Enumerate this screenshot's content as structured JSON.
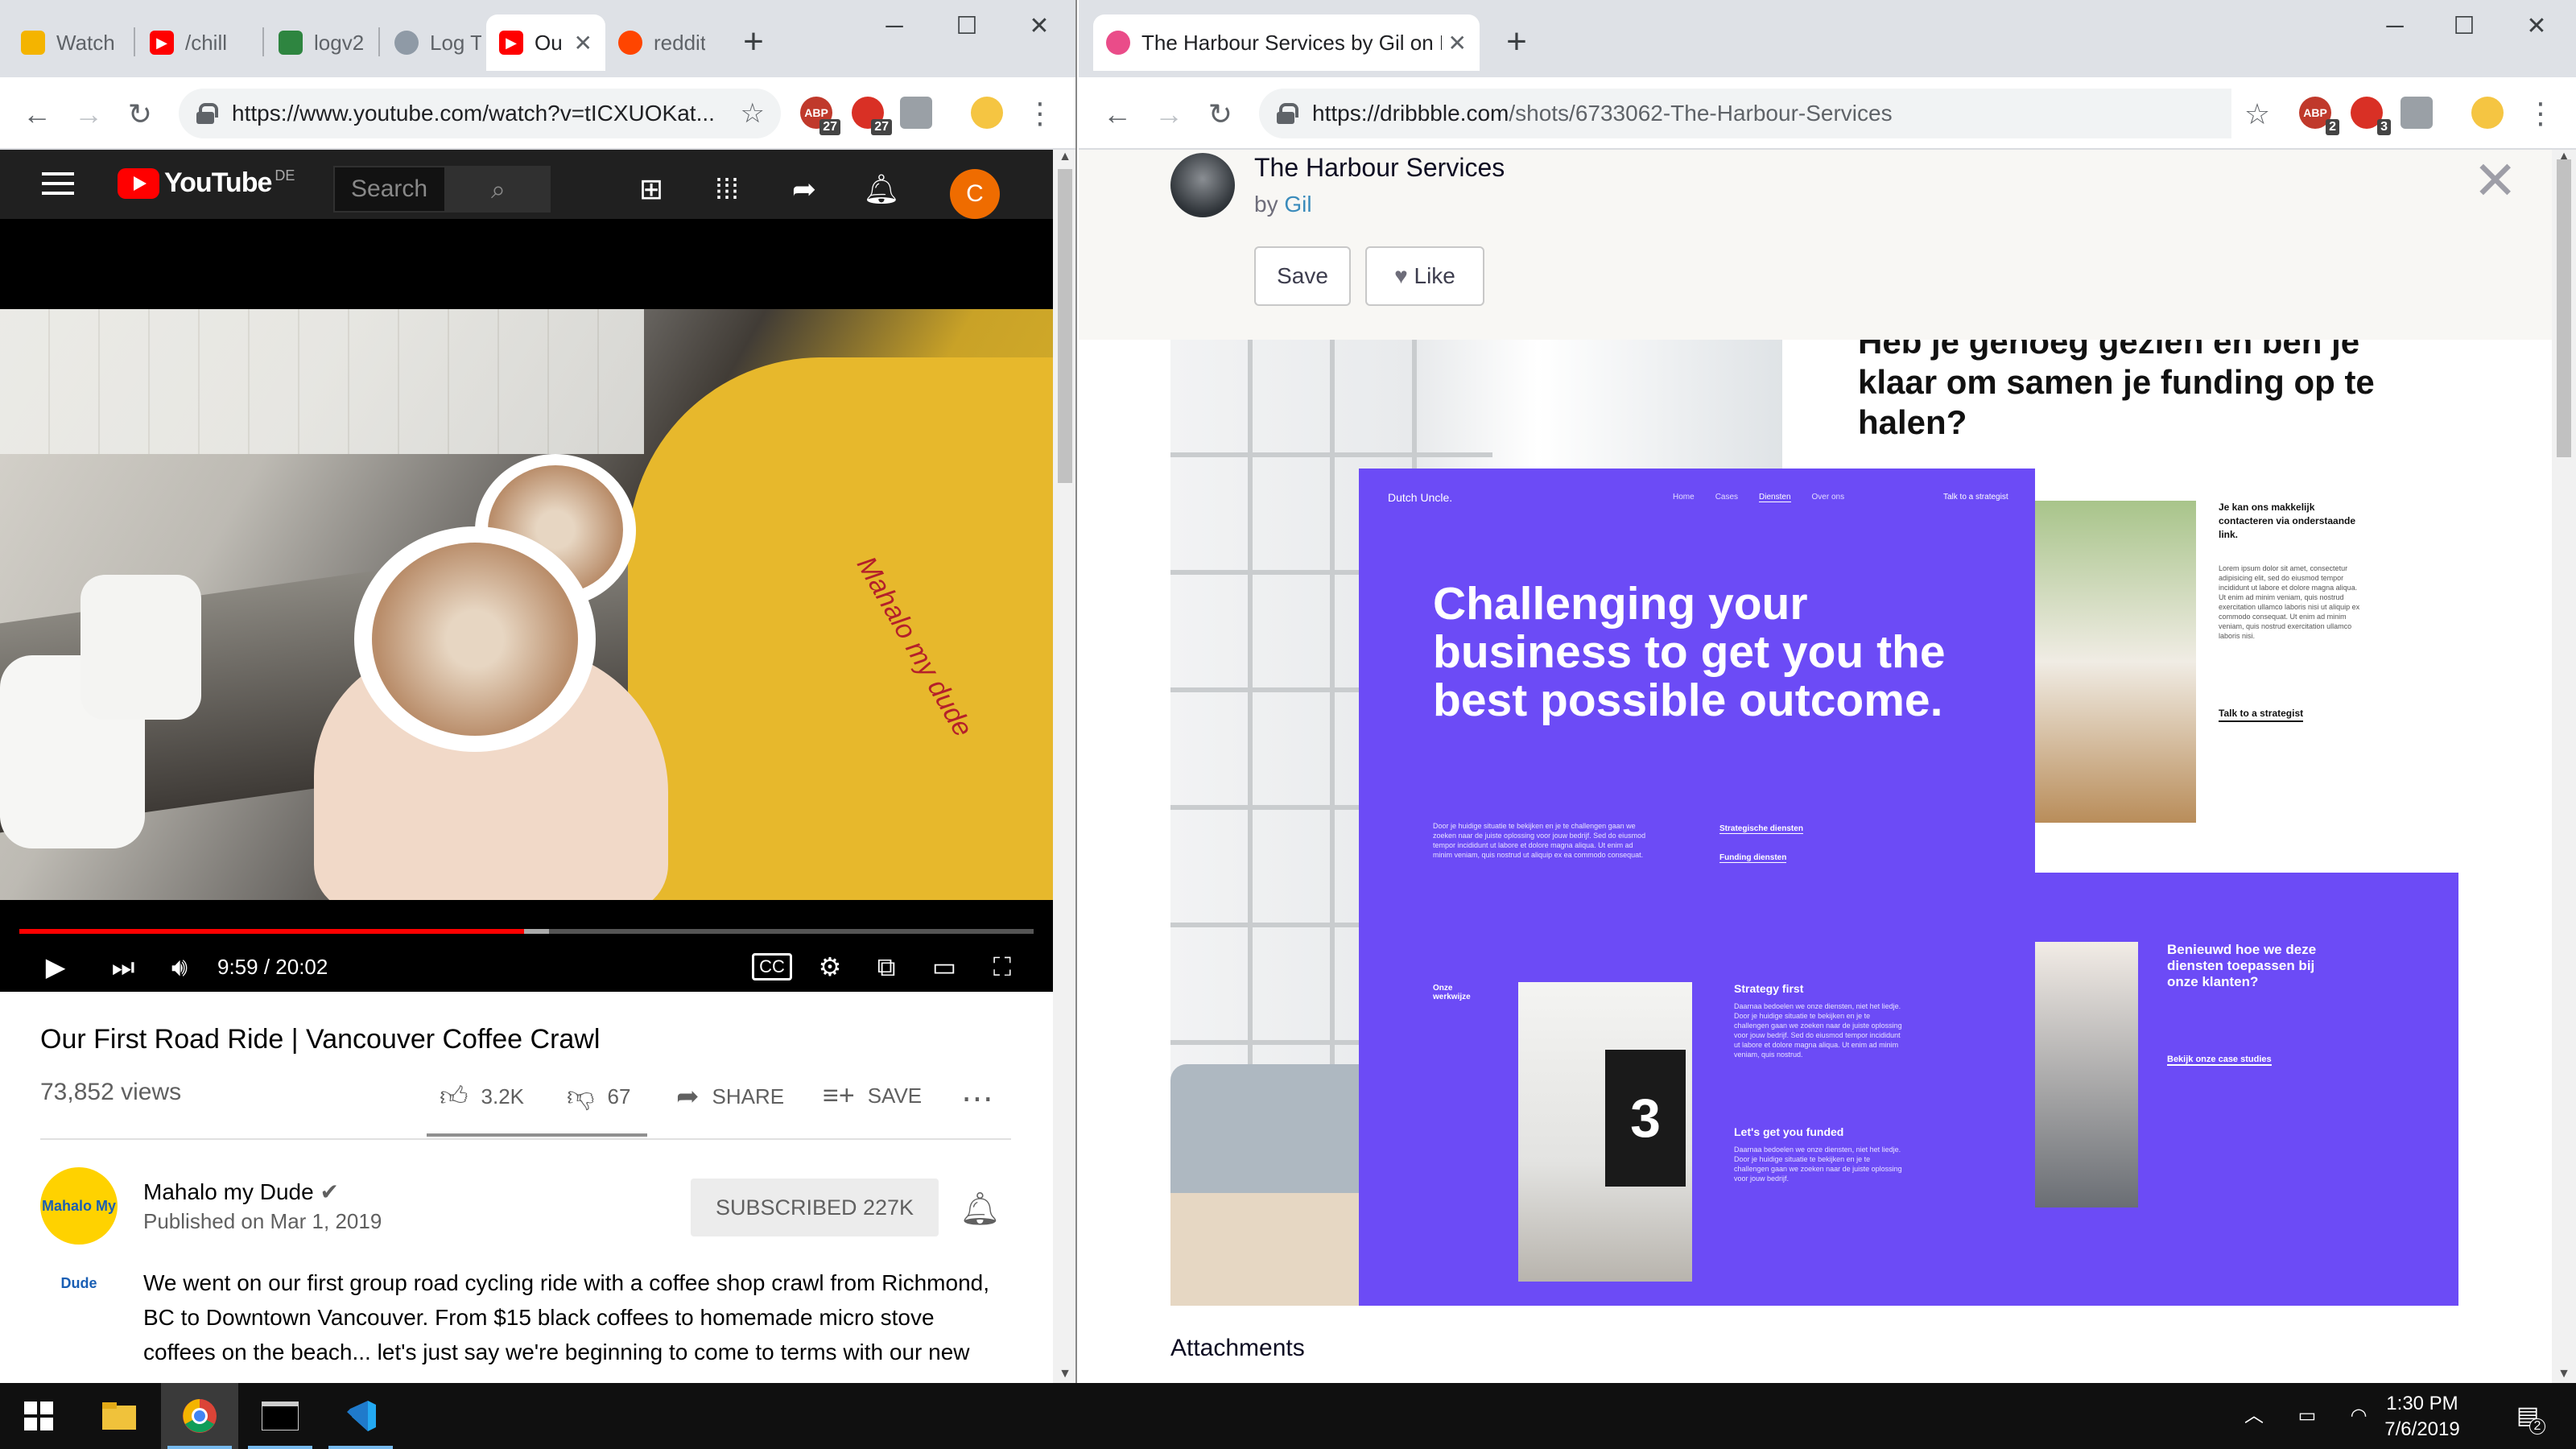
{
  "left_window": {
    "tabs": [
      {
        "label": "Watch",
        "color": "#f4b400"
      },
      {
        "label": "/chill",
        "color": "#ff0000"
      },
      {
        "label": "logv2",
        "color": "#2e8540"
      },
      {
        "label": "Log Ti",
        "color": "#8f9aa6"
      },
      {
        "label": "Ou",
        "color": "#ff0000",
        "active": true
      },
      {
        "label": "reddit",
        "color": "#ff4500"
      }
    ],
    "url": "https://www.youtube.com/watch?v=tICXUOKat...",
    "extensions": [
      {
        "label": "ABP",
        "badge": "27"
      },
      {
        "label": "",
        "badge": "27"
      }
    ]
  },
  "youtube": {
    "logo": "YouTube",
    "region": "DE",
    "search_placeholder": "Search",
    "avatar_letter": "C",
    "time": "9:59 / 20:02",
    "progress": {
      "played_fraction": 0.498,
      "loaded_fraction": 0.5225
    },
    "video_overlay_text": "Mahalo my dude",
    "video_title": "Our First Road Ride | Vancouver Coffee Crawl",
    "views": "73,852 views",
    "likes": "3.2K",
    "dislikes": "67",
    "share": "SHARE",
    "save": "SAVE",
    "channel_avatar_text": "Mahalo My Dude",
    "channel": "Mahalo my Dude",
    "published": "Published on Mar 1, 2019",
    "subscribe": "SUBSCRIBED  227K",
    "description": "We went on our first group road cycling ride with a coffee shop crawl from Richmond, BC to Downtown Vancouver. From $15 black coffees to homemade micro stove coffees on the beach... let's just say we're beginning to come to terms with our new"
  },
  "right_window": {
    "tab_title": "The Harbour Services by Gil on D",
    "url_host": "https://dribbble.com",
    "url_path": "/shots/6733062-The-Harbour-Services",
    "extensions": [
      {
        "label": "ABP",
        "badge": "2"
      },
      {
        "label": "",
        "badge": "3"
      }
    ]
  },
  "dribbble": {
    "title": "The Harbour Services",
    "by_prefix": "by",
    "author": "Gil",
    "save": "Save",
    "like": "Like",
    "attachments": "Attachments"
  },
  "shot": {
    "right_heading": "Heb je genoeg gezien en ben je klaar om samen je funding op te halen?",
    "brand": "Dutch Uncle.",
    "nav": [
      "Home",
      "Cases",
      "Diensten",
      "Over ons"
    ],
    "cta": "Talk to a strategist",
    "headline": "Challenging your business to get you the best possible outcome.",
    "intro": "Door je huidige situatie te bekijken en je te challengen gaan we zoeken naar de juiste oplossing voor jouw bedrijf. Sed do eiusmod tempor incididunt ut labore et dolore magna aliqua. Ut enim ad minim veniam, quis nostrud ut aliquip ex ea commodo consequat.",
    "link1": "Strategische diensten",
    "link2": "Funding diensten",
    "section_label": "Onze werkwijze",
    "strategy_title": "Strategy first",
    "strategy_body": "Daarnaa bedoelen we onze diensten, niet het liedje. Door je huidige situatie te bekijken en je te challengen gaan we zoeken naar de juiste oplossing voor jouw bedrijf. Sed do eiusmod tempor incididunt ut labore et dolore magna aliqua. Ut enim ad minim veniam, quis nostrud.",
    "funded_title": "Let's get you funded",
    "funded_body": "Daarnaa bedoelen we onze diensten, niet het liedje. Door je huidige situatie te bekijken en je te challengen gaan we zoeken naar de juiste oplossing voor jouw bedrijf.",
    "side_title": "Je kan ons makkelijk contacteren via onderstaande link.",
    "side_body": "Lorem ipsum dolor sit amet, consectetur adipisicing elit, sed do eiusmod tempor incididunt ut labore et dolore magna aliqua. Ut enim ad minim veniam, quis nostrud exercitation ullamco laboris nisi ut aliquip ex commodo consequat. Ut enim ad minim veniam, quis nostrud exercitation ullamco laboris nisi.",
    "side_link": "Talk to a strategist",
    "purple_title": "Benieuwd hoe we deze diensten toepassen bij onze klanten?",
    "purple_link": "Bekijk onze case studies",
    "screen_number": "3"
  },
  "taskbar": {
    "time": "1:30 PM",
    "date": "7/6/2019",
    "notifications": "2"
  }
}
